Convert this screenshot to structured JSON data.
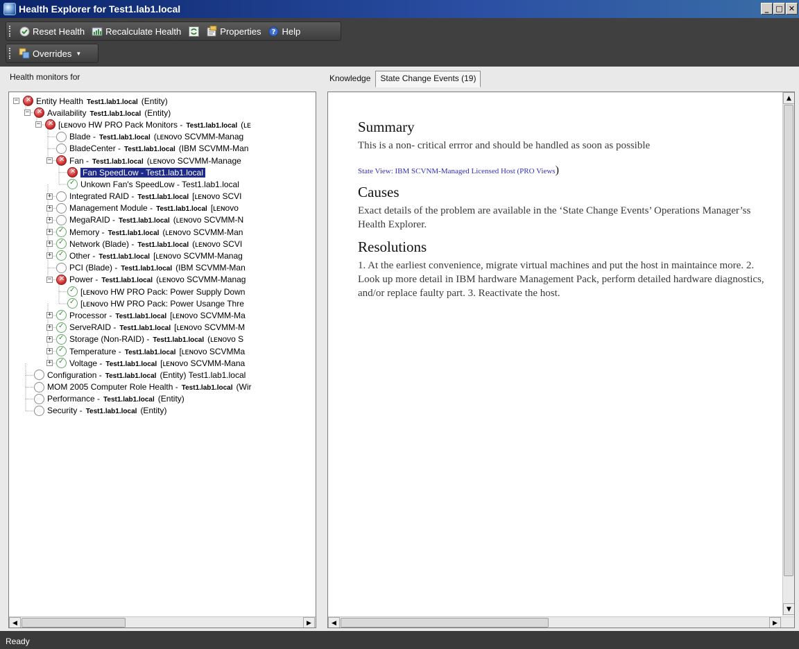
{
  "window": {
    "title": "Health Explorer for  Test1.lab1.local"
  },
  "toolbar": {
    "reset_health": "Reset Health",
    "recalculate_health": "Recalculate Health",
    "properties": "Properties",
    "help": "Help",
    "overrides": "Overrides"
  },
  "left": {
    "header": "Health monitors for"
  },
  "tree": [
    {
      "level": 0,
      "expander": "minus",
      "state": "critical",
      "text": "Entity Health",
      "bold": "Test1.lab1.local",
      "tail": "(Entity)"
    },
    {
      "level": 1,
      "expander": "minus",
      "state": "critical",
      "text": "Availability",
      "bold": "Test1.lab1.local",
      "tail": "(Entity)"
    },
    {
      "level": 2,
      "expander": "minus",
      "state": "critical",
      "text": "[ʟᴇɴᴏᴠᴏ HW PRO Pack Monitors -",
      "bold": "Test1.lab1.local",
      "tail": "(ʟᴇ"
    },
    {
      "level": 3,
      "expander": "none",
      "state": "empty",
      "text": "Blade -",
      "bold": "Test1.lab1.local",
      "tail": "(ʟᴇɴᴏᴠᴏ SCVMM-Manag"
    },
    {
      "level": 3,
      "expander": "none",
      "state": "empty",
      "text": "BladeCenter -",
      "bold": "Test1.lab1.local",
      "tail": "(IBM SCVMM-Man"
    },
    {
      "level": 3,
      "expander": "minus",
      "state": "critical",
      "text": "Fan -",
      "bold": "Test1.lab1.local",
      "tail": "(ʟᴇɴᴏᴠᴏ SCVMM-Manage"
    },
    {
      "level": 4,
      "expander": "none",
      "state": "critical",
      "text": "Fan SpeedLow - Test1.lab1.local",
      "bold": "",
      "tail": "",
      "selected": true
    },
    {
      "level": 4,
      "expander": "none",
      "state": "healthy",
      "text": "Unkown Fan's SpeedLow - Test1.lab1.local",
      "bold": "",
      "tail": ""
    },
    {
      "level": 3,
      "expander": "plus",
      "state": "empty",
      "text": "Integrated RAID -",
      "bold": "Test1.lab1.local",
      "tail": "[ʟᴇɴᴏᴠᴏ SCVI"
    },
    {
      "level": 3,
      "expander": "plus",
      "state": "empty",
      "text": "Management Module -",
      "bold": "Test1.lab1.local",
      "tail": "[ʟᴇɴᴏᴠᴏ"
    },
    {
      "level": 3,
      "expander": "plus",
      "state": "empty",
      "text": "MegaRAID -",
      "bold": "Test1.lab1.local",
      "tail": "(ʟᴇɴᴏᴠᴏ SCVMM-N"
    },
    {
      "level": 3,
      "expander": "plus",
      "state": "healthy",
      "text": "Memory -",
      "bold": "Test1.lab1.local",
      "tail": "(ʟᴇɴᴏᴠᴏ SCVMM-Man"
    },
    {
      "level": 3,
      "expander": "plus",
      "state": "healthy",
      "text": "Network (Blade) -",
      "bold": "Test1.lab1.local",
      "tail": "(ʟᴇɴᴏᴠᴏ SCVI"
    },
    {
      "level": 3,
      "expander": "plus",
      "state": "healthy",
      "text": "Other -",
      "bold": "Test1.lab1.local",
      "tail": "[ʟᴇɴᴏᴠᴏ SCVMM-Manag"
    },
    {
      "level": 3,
      "expander": "none",
      "state": "empty",
      "text": "PCI (Blade) -",
      "bold": "Test1.lab1.local",
      "tail": "(IBM SCVMM-Man"
    },
    {
      "level": 3,
      "expander": "minus",
      "state": "critical",
      "text": "Power -",
      "bold": "Test1.lab1.local",
      "tail": "(ʟᴇɴᴏᴠᴏ SCVMM-Manag"
    },
    {
      "level": 4,
      "expander": "none",
      "state": "healthy",
      "text": "[ʟᴇɴᴏᴠᴏ HW PRO Pack: Power Supply Down",
      "bold": "",
      "tail": ""
    },
    {
      "level": 4,
      "expander": "none",
      "state": "healthy",
      "text": "[ʟᴇɴᴏᴠᴏ HW PRO Pack: Power Usange Thre",
      "bold": "",
      "tail": ""
    },
    {
      "level": 3,
      "expander": "plus",
      "state": "healthy",
      "text": "Processor -",
      "bold": "Test1.lab1.local",
      "tail": "[ʟᴇɴᴏᴠᴏ SCVMM-Ma"
    },
    {
      "level": 3,
      "expander": "plus",
      "state": "healthy",
      "text": "ServeRAID -",
      "bold": "Test1.lab1.local",
      "tail": "[ʟᴇɴᴏᴠᴏ SCVMM-M"
    },
    {
      "level": 3,
      "expander": "plus",
      "state": "healthy",
      "text": "Storage (Non-RAID) -",
      "bold": "Test1.lab1.local",
      "tail": "(ʟᴇɴᴏᴠᴏ S"
    },
    {
      "level": 3,
      "expander": "plus",
      "state": "healthy",
      "text": "Temperature -",
      "bold": "Test1.lab1.local",
      "tail": "[ʟᴇɴᴏᴠᴏ SCVMMa"
    },
    {
      "level": 3,
      "expander": "plus",
      "state": "healthy",
      "text": "Voltage -",
      "bold": "Test1.lab1.local",
      "tail": "[ʟᴇɴᴏᴠᴏ SCVMM-Mana"
    },
    {
      "level": 1,
      "expander": "none",
      "state": "empty",
      "text": "Configuration -",
      "bold": "Test1.lab1.local",
      "tail": "(Entity) Test1.lab1.local"
    },
    {
      "level": 1,
      "expander": "none",
      "state": "empty",
      "text": "MOM 2005 Computer Role Health -",
      "bold": "Test1.lab1.local",
      "tail": "(Wir"
    },
    {
      "level": 1,
      "expander": "none",
      "state": "empty",
      "text": "Performance -",
      "bold": "Test1.lab1.local",
      "tail": "(Entity)"
    },
    {
      "level": 1,
      "expander": "none",
      "state": "empty",
      "text": "Security -",
      "bold": "Test1.lab1.local",
      "tail": "(Entity)"
    }
  ],
  "tabs": {
    "knowledge": "Knowledge",
    "state_change": "State Change Events (19)"
  },
  "knowledge": {
    "summary_heading": "Summary",
    "summary_text": "This is a non- critical errror and should be handled as soon as possible",
    "state_view_link": "State View: IBM SCVNM-Managed Licensed Host (PRO Views",
    "state_view_paren": ")",
    "causes_heading": "Causes",
    "causes_text": "Exact details of the problem are available in the ‘State Change Events’ Operations Manager’ss Health Explorer.",
    "resolutions_heading": "Resolutions",
    "resolutions_text": "1. At the earliest convenience, migrate virtual machines and put the host in maintaince more. 2. Look up more detail in IBM hardware Management Pack, perform detailed hardware diagnostics, and/or replace faulty part. 3. Reactivate the host."
  },
  "statusbar": {
    "text": "Ready"
  },
  "colors": {
    "selection": "#1f2a8a",
    "critical": "#d03030",
    "healthy": "#3b8a3b",
    "link": "#3030c0"
  }
}
